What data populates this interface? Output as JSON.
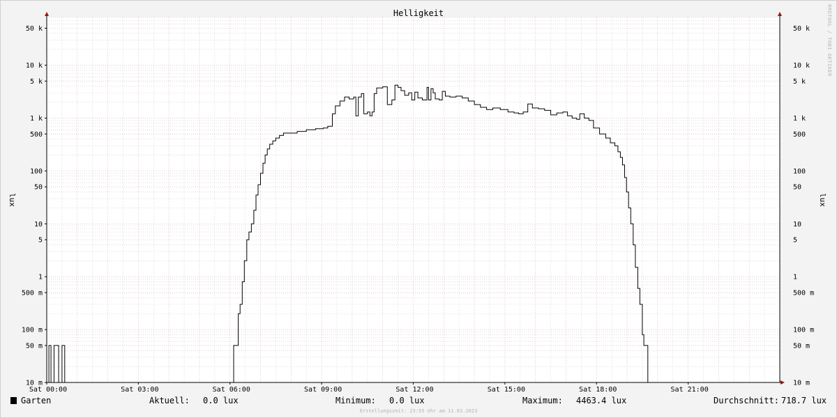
{
  "colors": {
    "background": "#f3f3f3",
    "plot_background": "#ffffff",
    "major_grid": "#e0a0a0",
    "minor_grid": "#c8c8c8",
    "line": "#000000",
    "axis": "#000000",
    "arrow": "#8b1a1a"
  },
  "watermark": "RRDTOOL / TOBI OETIKER",
  "footer": "Erstellungszeit: 23:55 Uhr am 11.03.2023",
  "legend": {
    "series_name": "Garten",
    "aktuell_label": "Aktuell:",
    "aktuell_value": "0.0 lux",
    "minimum_label": "Minimum:",
    "minimum_value": "0.0 lux",
    "maximum_label": "Maximum:",
    "maximum_value": "4463.4 lux",
    "durchschnitt_label": "Durchschnitt:",
    "durchschnitt_value": "718.7 lux"
  },
  "chart_data": {
    "type": "line",
    "title": "Helligkeit",
    "ylabel": "lux",
    "ylabel_right": "lux",
    "y_scale": "log",
    "ylim": [
      0.01,
      80000
    ],
    "xlim": [
      0,
      24
    ],
    "grid": true,
    "y_ticks": [
      {
        "value": 0.01,
        "label": "10 m"
      },
      {
        "value": 0.05,
        "label": "50 m"
      },
      {
        "value": 0.1,
        "label": "100 m"
      },
      {
        "value": 0.5,
        "label": "500 m"
      },
      {
        "value": 1,
        "label": "1"
      },
      {
        "value": 5,
        "label": "5"
      },
      {
        "value": 10,
        "label": "10"
      },
      {
        "value": 50,
        "label": "50"
      },
      {
        "value": 100,
        "label": "100"
      },
      {
        "value": 500,
        "label": "500"
      },
      {
        "value": 1000,
        "label": "1 k"
      },
      {
        "value": 5000,
        "label": "5 k"
      },
      {
        "value": 10000,
        "label": "10 k"
      },
      {
        "value": 50000,
        "label": "50 k"
      }
    ],
    "x_ticks": [
      {
        "value": 0,
        "label": "Sat 00:00"
      },
      {
        "value": 3,
        "label": "Sat 03:00"
      },
      {
        "value": 6,
        "label": "Sat 06:00"
      },
      {
        "value": 9,
        "label": "Sat 09:00"
      },
      {
        "value": 12,
        "label": "Sat 12:00"
      },
      {
        "value": 15,
        "label": "Sat 15:00"
      },
      {
        "value": 18,
        "label": "Sat 18:00"
      },
      {
        "value": 21,
        "label": "Sat 21:00"
      }
    ],
    "series": [
      {
        "name": "Garten",
        "points": [
          [
            0.0,
            0.01
          ],
          [
            0.05,
            0.01
          ],
          [
            0.07,
            0.05
          ],
          [
            0.12,
            0.05
          ],
          [
            0.14,
            0.01
          ],
          [
            0.22,
            0.01
          ],
          [
            0.24,
            0.05
          ],
          [
            0.37,
            0.05
          ],
          [
            0.39,
            0.01
          ],
          [
            0.48,
            0.01
          ],
          [
            0.5,
            0.05
          ],
          [
            0.57,
            0.05
          ],
          [
            0.59,
            0.01
          ],
          [
            6.1,
            0.01
          ],
          [
            6.12,
            0.05
          ],
          [
            6.25,
            0.05
          ],
          [
            6.27,
            0.2
          ],
          [
            6.33,
            0.3
          ],
          [
            6.4,
            0.8
          ],
          [
            6.47,
            2
          ],
          [
            6.55,
            5
          ],
          [
            6.62,
            7
          ],
          [
            6.7,
            10
          ],
          [
            6.78,
            18
          ],
          [
            6.85,
            35
          ],
          [
            6.92,
            55
          ],
          [
            7.0,
            90
          ],
          [
            7.08,
            140
          ],
          [
            7.15,
            200
          ],
          [
            7.22,
            260
          ],
          [
            7.3,
            320
          ],
          [
            7.4,
            370
          ],
          [
            7.5,
            420
          ],
          [
            7.62,
            470
          ],
          [
            7.75,
            520
          ],
          [
            8.0,
            520
          ],
          [
            8.2,
            560
          ],
          [
            8.5,
            600
          ],
          [
            8.8,
            630
          ],
          [
            9.05,
            650
          ],
          [
            9.2,
            700
          ],
          [
            9.35,
            1200
          ],
          [
            9.45,
            1700
          ],
          [
            9.6,
            2100
          ],
          [
            9.75,
            2500
          ],
          [
            9.9,
            2300
          ],
          [
            10.05,
            2500
          ],
          [
            10.12,
            1100
          ],
          [
            10.2,
            2500
          ],
          [
            10.3,
            2900
          ],
          [
            10.38,
            1200
          ],
          [
            10.5,
            1300
          ],
          [
            10.58,
            1100
          ],
          [
            10.65,
            1300
          ],
          [
            10.72,
            2900
          ],
          [
            10.8,
            3700
          ],
          [
            11.0,
            3900
          ],
          [
            11.15,
            1800
          ],
          [
            11.3,
            2200
          ],
          [
            11.4,
            4200
          ],
          [
            11.5,
            3800
          ],
          [
            11.6,
            3300
          ],
          [
            11.72,
            2700
          ],
          [
            11.85,
            3000
          ],
          [
            11.95,
            2200
          ],
          [
            12.05,
            3100
          ],
          [
            12.15,
            2400
          ],
          [
            12.3,
            2200
          ],
          [
            12.45,
            3800
          ],
          [
            12.5,
            2200
          ],
          [
            12.58,
            3600
          ],
          [
            12.65,
            3000
          ],
          [
            12.72,
            2300
          ],
          [
            12.85,
            2200
          ],
          [
            12.95,
            3200
          ],
          [
            13.05,
            2600
          ],
          [
            13.2,
            2500
          ],
          [
            13.4,
            2600
          ],
          [
            13.6,
            2400
          ],
          [
            13.8,
            2100
          ],
          [
            14.0,
            1800
          ],
          [
            14.2,
            1600
          ],
          [
            14.4,
            1450
          ],
          [
            14.6,
            1550
          ],
          [
            14.85,
            1450
          ],
          [
            15.1,
            1300
          ],
          [
            15.3,
            1250
          ],
          [
            15.45,
            1200
          ],
          [
            15.6,
            1300
          ],
          [
            15.75,
            1850
          ],
          [
            15.9,
            1550
          ],
          [
            16.1,
            1500
          ],
          [
            16.3,
            1400
          ],
          [
            16.5,
            1150
          ],
          [
            16.7,
            1250
          ],
          [
            16.9,
            1300
          ],
          [
            17.05,
            1100
          ],
          [
            17.2,
            1000
          ],
          [
            17.35,
            950
          ],
          [
            17.45,
            1200
          ],
          [
            17.6,
            1000
          ],
          [
            17.75,
            900
          ],
          [
            17.9,
            650
          ],
          [
            18.1,
            500
          ],
          [
            18.3,
            420
          ],
          [
            18.45,
            340
          ],
          [
            18.6,
            300
          ],
          [
            18.7,
            230
          ],
          [
            18.78,
            180
          ],
          [
            18.85,
            130
          ],
          [
            18.92,
            75
          ],
          [
            18.98,
            40
          ],
          [
            19.05,
            20
          ],
          [
            19.12,
            10
          ],
          [
            19.2,
            4
          ],
          [
            19.27,
            1.5
          ],
          [
            19.35,
            0.6
          ],
          [
            19.42,
            0.3
          ],
          [
            19.5,
            0.08
          ],
          [
            19.55,
            0.05
          ],
          [
            19.65,
            0.05
          ],
          [
            19.68,
            0.01
          ],
          [
            24.0,
            0.01
          ]
        ]
      }
    ]
  }
}
